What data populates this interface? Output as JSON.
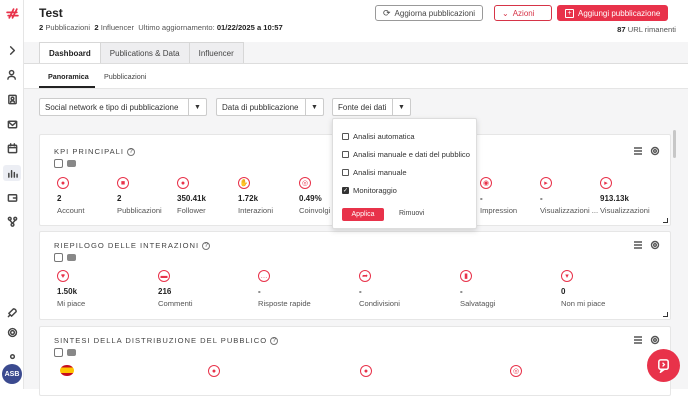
{
  "header": {
    "title": "Test",
    "publications_count": "2",
    "publications_label": "Pubblicazioni",
    "influencers_count": "2",
    "influencers_label": "Influencer",
    "updated_label": "Ultimo aggiornamento:",
    "updated_value": "01/22/2025 a 10:57",
    "refresh_label": "Aggiorna pubblicazioni",
    "actions_label": "Azioni",
    "add_label": "Aggiungi pubblicazione",
    "url_count": "87",
    "url_label": "URL rimanenti"
  },
  "tabs": [
    "Dashboard",
    "Publications & Data",
    "Influencer"
  ],
  "subtabs": [
    "Panoramica",
    "Pubblicazioni"
  ],
  "filters": {
    "social": "Social network e tipo di pubblicazione",
    "date": "Data di pubblicazione",
    "source": "Fonte dei dati"
  },
  "dropdown": {
    "options": [
      {
        "label": "Analisi automatica",
        "checked": false
      },
      {
        "label": "Analisi manuale e dati del pubblico",
        "checked": false
      },
      {
        "label": "Analisi manuale",
        "checked": false
      },
      {
        "label": "Monitoraggio",
        "checked": true
      }
    ],
    "apply": "Applica",
    "remove": "Rimuovi"
  },
  "kpi": {
    "title": "KPI PRINCIPALI",
    "items": [
      {
        "value": "2",
        "label": "Account",
        "icon": "user-icon"
      },
      {
        "value": "2",
        "label": "Pubblicazioni",
        "icon": "post-icon"
      },
      {
        "value": "350.41k",
        "label": "Follower",
        "icon": "users-icon"
      },
      {
        "value": "1.72k",
        "label": "Interazioni",
        "icon": "hand-icon"
      },
      {
        "value": "0.49%",
        "label": "Coinvolgi",
        "icon": "target-icon"
      },
      {
        "value": "-",
        "label": "Impression",
        "icon": "eye-icon"
      },
      {
        "value": "-",
        "label": "Visualizzazioni ...",
        "icon": "play-icon"
      },
      {
        "value": "913.13k",
        "label": "Visualizzazioni",
        "icon": "play-circle-icon"
      }
    ]
  },
  "interactions": {
    "title": "RIEPILOGO DELLE INTERAZIONI",
    "items": [
      {
        "value": "1.50k",
        "label": "Mi piace",
        "icon": "heart-icon"
      },
      {
        "value": "216",
        "label": "Commenti",
        "icon": "comment-icon"
      },
      {
        "value": "-",
        "label": "Risposte rapide",
        "icon": "reply-icon"
      },
      {
        "value": "-",
        "label": "Condivisioni",
        "icon": "share-icon"
      },
      {
        "value": "-",
        "label": "Salvataggi",
        "icon": "bookmark-icon"
      },
      {
        "value": "0",
        "label": "Non mi piace",
        "icon": "dislike-icon"
      }
    ]
  },
  "audience": {
    "title": "SINTESI DELLA DISTRIBUZIONE DEL PUBBLICO"
  },
  "user": {
    "initials": "ASB"
  },
  "colors": {
    "accent": "#e8324a",
    "youtube": "#c4302b"
  }
}
